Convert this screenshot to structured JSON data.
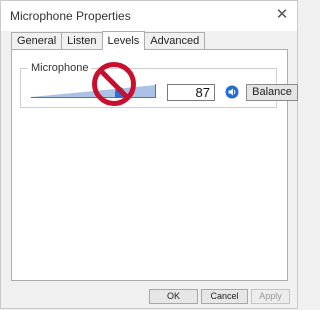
{
  "window": {
    "title": "Microphone Properties",
    "close_glyph": "✕"
  },
  "tabs": [
    {
      "label": "General",
      "active": false
    },
    {
      "label": "Listen",
      "active": false
    },
    {
      "label": "Levels",
      "active": true
    },
    {
      "label": "Advanced",
      "active": false
    }
  ],
  "levels": {
    "group_label": "Microphone",
    "level_value": "87",
    "level_fraction": 0.87,
    "speaker_icon": "speaker-icon",
    "muted_overlay_icon": "no-entry-icon",
    "balance_label": "Balance"
  },
  "footer": {
    "ok_label": "OK",
    "cancel_label": "Cancel",
    "apply_label": "Apply",
    "apply_enabled": false
  },
  "colors": {
    "accent": "#2a6fd6",
    "slider_fill": "#a9c2e6",
    "no_sign": "#c8102e"
  }
}
